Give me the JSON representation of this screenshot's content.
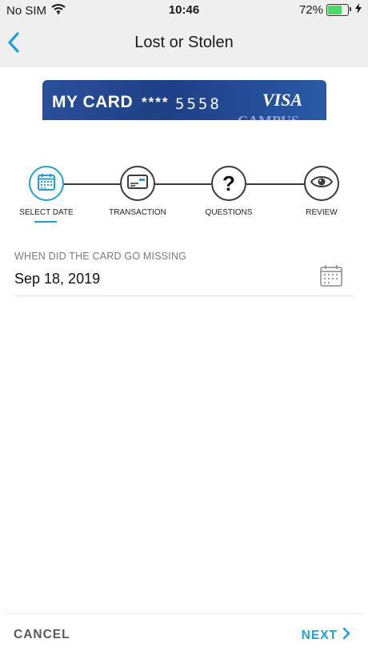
{
  "status_bar": {
    "carrier": "No SIM",
    "time": "10:46",
    "battery_percent": "72%",
    "battery_level": 0.72,
    "icons": [
      "wifi-icon",
      "battery-icon",
      "charging-bolt-icon"
    ]
  },
  "nav": {
    "title": "Lost or Stolen",
    "back_icon": "chevron-left-icon"
  },
  "card": {
    "name": "MY CARD",
    "mask": "****",
    "last_four": "5558",
    "brand": "VISA",
    "partial_text": "CAMPUS"
  },
  "stepper": {
    "steps": [
      {
        "label": "SELECT DATE",
        "icon": "calendar-icon",
        "active": true
      },
      {
        "label": "TRANSACTION",
        "icon": "credit-card-icon",
        "active": false
      },
      {
        "label": "QUESTIONS",
        "icon": "question-mark-icon",
        "active": false
      },
      {
        "label": "REVIEW",
        "icon": "eye-icon",
        "active": false
      }
    ]
  },
  "form": {
    "label": "WHEN DID THE CARD GO MISSING",
    "value": "Sep 18, 2019",
    "picker_icon": "calendar-icon"
  },
  "footer": {
    "cancel_label": "CANCEL",
    "next_label": "NEXT",
    "next_icon": "chevron-right-icon"
  },
  "colors": {
    "accent": "#1da0dc",
    "bar_background": "#efefef",
    "card_blue": "#1f3f86",
    "battery_green": "#4cd964"
  }
}
